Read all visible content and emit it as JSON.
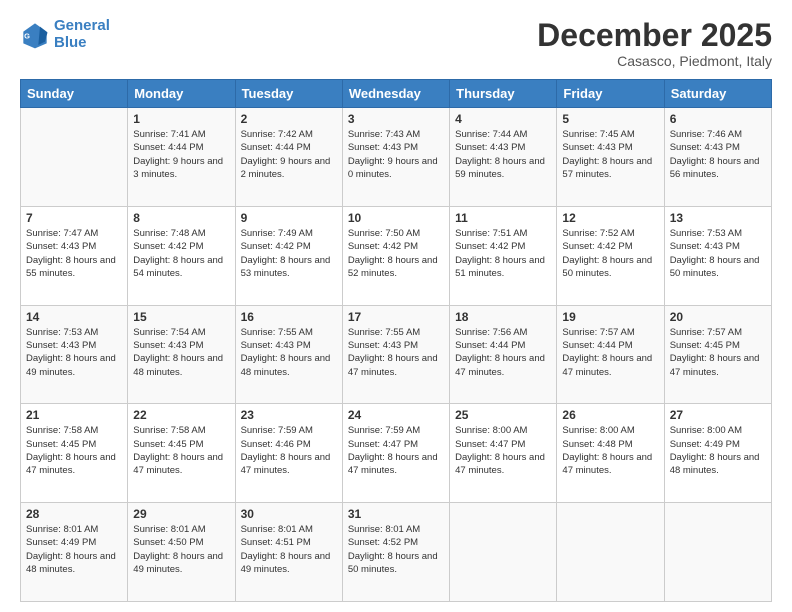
{
  "logo": {
    "line1": "General",
    "line2": "Blue"
  },
  "header": {
    "month": "December 2025",
    "location": "Casasco, Piedmont, Italy"
  },
  "weekdays": [
    "Sunday",
    "Monday",
    "Tuesday",
    "Wednesday",
    "Thursday",
    "Friday",
    "Saturday"
  ],
  "weeks": [
    [
      {
        "day": "",
        "sunrise": "",
        "sunset": "",
        "daylight": ""
      },
      {
        "day": "1",
        "sunrise": "Sunrise: 7:41 AM",
        "sunset": "Sunset: 4:44 PM",
        "daylight": "Daylight: 9 hours and 3 minutes."
      },
      {
        "day": "2",
        "sunrise": "Sunrise: 7:42 AM",
        "sunset": "Sunset: 4:44 PM",
        "daylight": "Daylight: 9 hours and 2 minutes."
      },
      {
        "day": "3",
        "sunrise": "Sunrise: 7:43 AM",
        "sunset": "Sunset: 4:43 PM",
        "daylight": "Daylight: 9 hours and 0 minutes."
      },
      {
        "day": "4",
        "sunrise": "Sunrise: 7:44 AM",
        "sunset": "Sunset: 4:43 PM",
        "daylight": "Daylight: 8 hours and 59 minutes."
      },
      {
        "day": "5",
        "sunrise": "Sunrise: 7:45 AM",
        "sunset": "Sunset: 4:43 PM",
        "daylight": "Daylight: 8 hours and 57 minutes."
      },
      {
        "day": "6",
        "sunrise": "Sunrise: 7:46 AM",
        "sunset": "Sunset: 4:43 PM",
        "daylight": "Daylight: 8 hours and 56 minutes."
      }
    ],
    [
      {
        "day": "7",
        "sunrise": "Sunrise: 7:47 AM",
        "sunset": "Sunset: 4:43 PM",
        "daylight": "Daylight: 8 hours and 55 minutes."
      },
      {
        "day": "8",
        "sunrise": "Sunrise: 7:48 AM",
        "sunset": "Sunset: 4:42 PM",
        "daylight": "Daylight: 8 hours and 54 minutes."
      },
      {
        "day": "9",
        "sunrise": "Sunrise: 7:49 AM",
        "sunset": "Sunset: 4:42 PM",
        "daylight": "Daylight: 8 hours and 53 minutes."
      },
      {
        "day": "10",
        "sunrise": "Sunrise: 7:50 AM",
        "sunset": "Sunset: 4:42 PM",
        "daylight": "Daylight: 8 hours and 52 minutes."
      },
      {
        "day": "11",
        "sunrise": "Sunrise: 7:51 AM",
        "sunset": "Sunset: 4:42 PM",
        "daylight": "Daylight: 8 hours and 51 minutes."
      },
      {
        "day": "12",
        "sunrise": "Sunrise: 7:52 AM",
        "sunset": "Sunset: 4:42 PM",
        "daylight": "Daylight: 8 hours and 50 minutes."
      },
      {
        "day": "13",
        "sunrise": "Sunrise: 7:53 AM",
        "sunset": "Sunset: 4:43 PM",
        "daylight": "Daylight: 8 hours and 50 minutes."
      }
    ],
    [
      {
        "day": "14",
        "sunrise": "Sunrise: 7:53 AM",
        "sunset": "Sunset: 4:43 PM",
        "daylight": "Daylight: 8 hours and 49 minutes."
      },
      {
        "day": "15",
        "sunrise": "Sunrise: 7:54 AM",
        "sunset": "Sunset: 4:43 PM",
        "daylight": "Daylight: 8 hours and 48 minutes."
      },
      {
        "day": "16",
        "sunrise": "Sunrise: 7:55 AM",
        "sunset": "Sunset: 4:43 PM",
        "daylight": "Daylight: 8 hours and 48 minutes."
      },
      {
        "day": "17",
        "sunrise": "Sunrise: 7:55 AM",
        "sunset": "Sunset: 4:43 PM",
        "daylight": "Daylight: 8 hours and 47 minutes."
      },
      {
        "day": "18",
        "sunrise": "Sunrise: 7:56 AM",
        "sunset": "Sunset: 4:44 PM",
        "daylight": "Daylight: 8 hours and 47 minutes."
      },
      {
        "day": "19",
        "sunrise": "Sunrise: 7:57 AM",
        "sunset": "Sunset: 4:44 PM",
        "daylight": "Daylight: 8 hours and 47 minutes."
      },
      {
        "day": "20",
        "sunrise": "Sunrise: 7:57 AM",
        "sunset": "Sunset: 4:45 PM",
        "daylight": "Daylight: 8 hours and 47 minutes."
      }
    ],
    [
      {
        "day": "21",
        "sunrise": "Sunrise: 7:58 AM",
        "sunset": "Sunset: 4:45 PM",
        "daylight": "Daylight: 8 hours and 47 minutes."
      },
      {
        "day": "22",
        "sunrise": "Sunrise: 7:58 AM",
        "sunset": "Sunset: 4:45 PM",
        "daylight": "Daylight: 8 hours and 47 minutes."
      },
      {
        "day": "23",
        "sunrise": "Sunrise: 7:59 AM",
        "sunset": "Sunset: 4:46 PM",
        "daylight": "Daylight: 8 hours and 47 minutes."
      },
      {
        "day": "24",
        "sunrise": "Sunrise: 7:59 AM",
        "sunset": "Sunset: 4:47 PM",
        "daylight": "Daylight: 8 hours and 47 minutes."
      },
      {
        "day": "25",
        "sunrise": "Sunrise: 8:00 AM",
        "sunset": "Sunset: 4:47 PM",
        "daylight": "Daylight: 8 hours and 47 minutes."
      },
      {
        "day": "26",
        "sunrise": "Sunrise: 8:00 AM",
        "sunset": "Sunset: 4:48 PM",
        "daylight": "Daylight: 8 hours and 47 minutes."
      },
      {
        "day": "27",
        "sunrise": "Sunrise: 8:00 AM",
        "sunset": "Sunset: 4:49 PM",
        "daylight": "Daylight: 8 hours and 48 minutes."
      }
    ],
    [
      {
        "day": "28",
        "sunrise": "Sunrise: 8:01 AM",
        "sunset": "Sunset: 4:49 PM",
        "daylight": "Daylight: 8 hours and 48 minutes."
      },
      {
        "day": "29",
        "sunrise": "Sunrise: 8:01 AM",
        "sunset": "Sunset: 4:50 PM",
        "daylight": "Daylight: 8 hours and 49 minutes."
      },
      {
        "day": "30",
        "sunrise": "Sunrise: 8:01 AM",
        "sunset": "Sunset: 4:51 PM",
        "daylight": "Daylight: 8 hours and 49 minutes."
      },
      {
        "day": "31",
        "sunrise": "Sunrise: 8:01 AM",
        "sunset": "Sunset: 4:52 PM",
        "daylight": "Daylight: 8 hours and 50 minutes."
      },
      {
        "day": "",
        "sunrise": "",
        "sunset": "",
        "daylight": ""
      },
      {
        "day": "",
        "sunrise": "",
        "sunset": "",
        "daylight": ""
      },
      {
        "day": "",
        "sunrise": "",
        "sunset": "",
        "daylight": ""
      }
    ]
  ]
}
